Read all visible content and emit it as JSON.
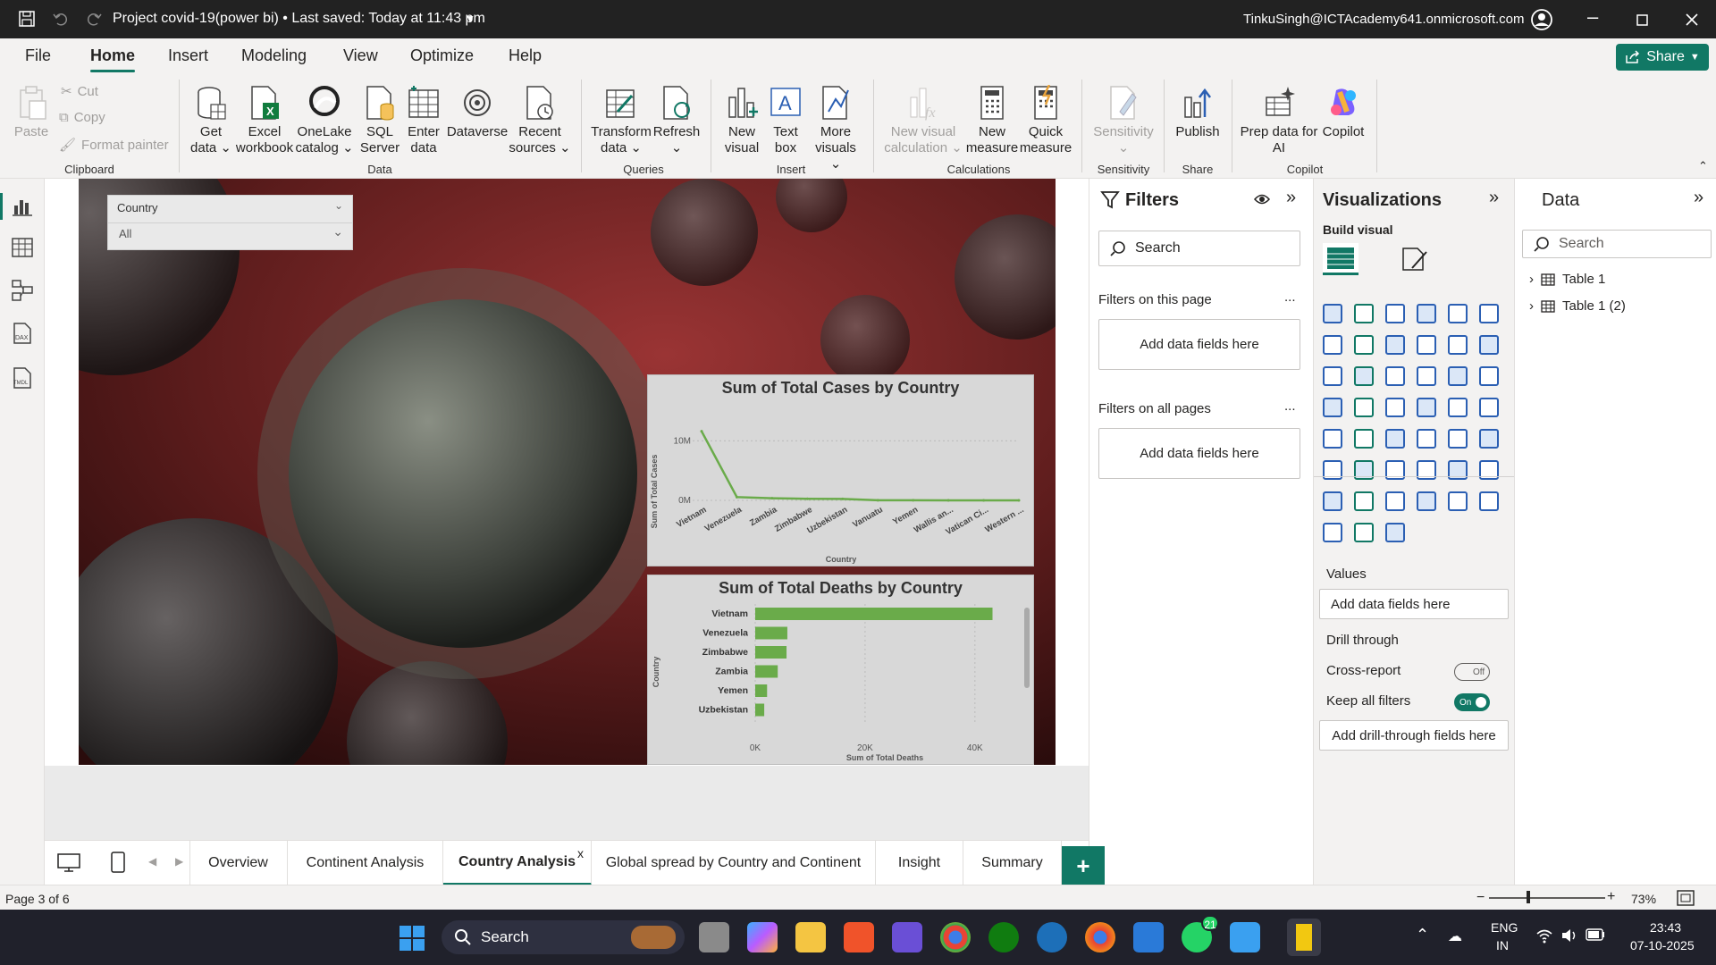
{
  "titlebar": {
    "title": "Project covid-19(power bi) • Last saved: Today at 11:43 pm",
    "account": "TinkuSingh@ICTAcademy641.onmicrosoft.com"
  },
  "menu": {
    "items": [
      "File",
      "Home",
      "Insert",
      "Modeling",
      "View",
      "Optimize",
      "Help"
    ],
    "active": "Home",
    "share": "Share"
  },
  "ribbon": {
    "clipboard": {
      "paste": "Paste",
      "cut": "Cut",
      "copy": "Copy",
      "format_painter": "Format painter",
      "group": "Clipboard"
    },
    "data": {
      "get_data": "Get data ⌄",
      "excel": "Excel workbook",
      "onelake": "OneLake catalog ⌄",
      "sql": "SQL Server",
      "enter": "Enter data",
      "dataverse": "Dataverse",
      "recent": "Recent sources ⌄",
      "group": "Data"
    },
    "queries": {
      "transform": "Transform data ⌄",
      "refresh": "Refresh ⌄",
      "group": "Queries"
    },
    "insert": {
      "new_visual": "New visual",
      "text_box": "Text box",
      "more_visuals": "More visuals ⌄",
      "group": "Insert"
    },
    "calculations": {
      "new_visual_calc": "New visual calculation ⌄",
      "new_measure": "New measure",
      "quick_measure": "Quick measure",
      "group": "Calculations"
    },
    "sensitivity": {
      "label": "Sensitivity ⌄",
      "group": "Sensitivity"
    },
    "share": {
      "publish": "Publish",
      "group": "Share"
    },
    "copilot": {
      "prep": "Prep data for AI",
      "copilot": "Copilot",
      "group": "Copilot"
    }
  },
  "slicer": {
    "title": "Country",
    "value": "All"
  },
  "chart_data": [
    {
      "type": "line",
      "title": "Sum of Total Cases by Country",
      "xlabel": "Country",
      "ylabel": "Sum of Total Cases",
      "y_ticks": [
        "10M",
        "0M"
      ],
      "ylim": [
        0,
        12000000
      ],
      "categories": [
        "Vietnam",
        "Venezuela",
        "Zambia",
        "Zimbabwe",
        "Uzbekistan",
        "Vanuatu",
        "Yemen",
        "Wallis an...",
        "Vatican Ci...",
        "Western ..."
      ],
      "values": [
        11600000,
        550000,
        350000,
        270000,
        250000,
        12000,
        12000,
        3500,
        30,
        10
      ],
      "color": "#6aab4a",
      "grid": true
    },
    {
      "type": "bar",
      "orientation": "horizontal",
      "title": "Sum of Total Deaths by Country",
      "xlabel": "Sum of Total Deaths",
      "ylabel": "Country",
      "x_ticks": [
        "0K",
        "20K",
        "40K"
      ],
      "xlim": [
        0,
        48000
      ],
      "categories": [
        "Vietnam",
        "Venezuela",
        "Zimbabwe",
        "Zambia",
        "Yemen",
        "Uzbekistan"
      ],
      "values": [
        43200,
        5850,
        5700,
        4100,
        2160,
        1640
      ],
      "color": "#6aab4a",
      "grid": true
    }
  ],
  "filters": {
    "title": "Filters",
    "search": "Search",
    "page_label": "Filters on this page",
    "all_label": "Filters on all pages",
    "add": "Add data fields here",
    "more": "..."
  },
  "viz": {
    "title": "Visualizations",
    "build": "Build visual",
    "values": "Values",
    "add_values": "Add data fields here",
    "drill": "Drill through",
    "cross": "Cross-report",
    "cross_state": "Off",
    "keep": "Keep all filters",
    "keep_state": "On",
    "add_drill": "Add drill-through fields here"
  },
  "datapane": {
    "title": "Data",
    "search": "Search",
    "tables": [
      "Table 1",
      "Table 1 (2)"
    ]
  },
  "tabs": [
    "Overview",
    "Continent Analysis",
    "Country Analysis",
    "Global spread by Country and Continent",
    "Insight",
    "Summary"
  ],
  "active_tab": "Country Analysis",
  "status": {
    "page": "Page 3 of 6",
    "zoom": "73%"
  },
  "taskbar": {
    "search": "Search",
    "lang1": "ENG",
    "lang2": "IN",
    "time": "23:43",
    "date": "07-10-2025",
    "badge": "21"
  }
}
